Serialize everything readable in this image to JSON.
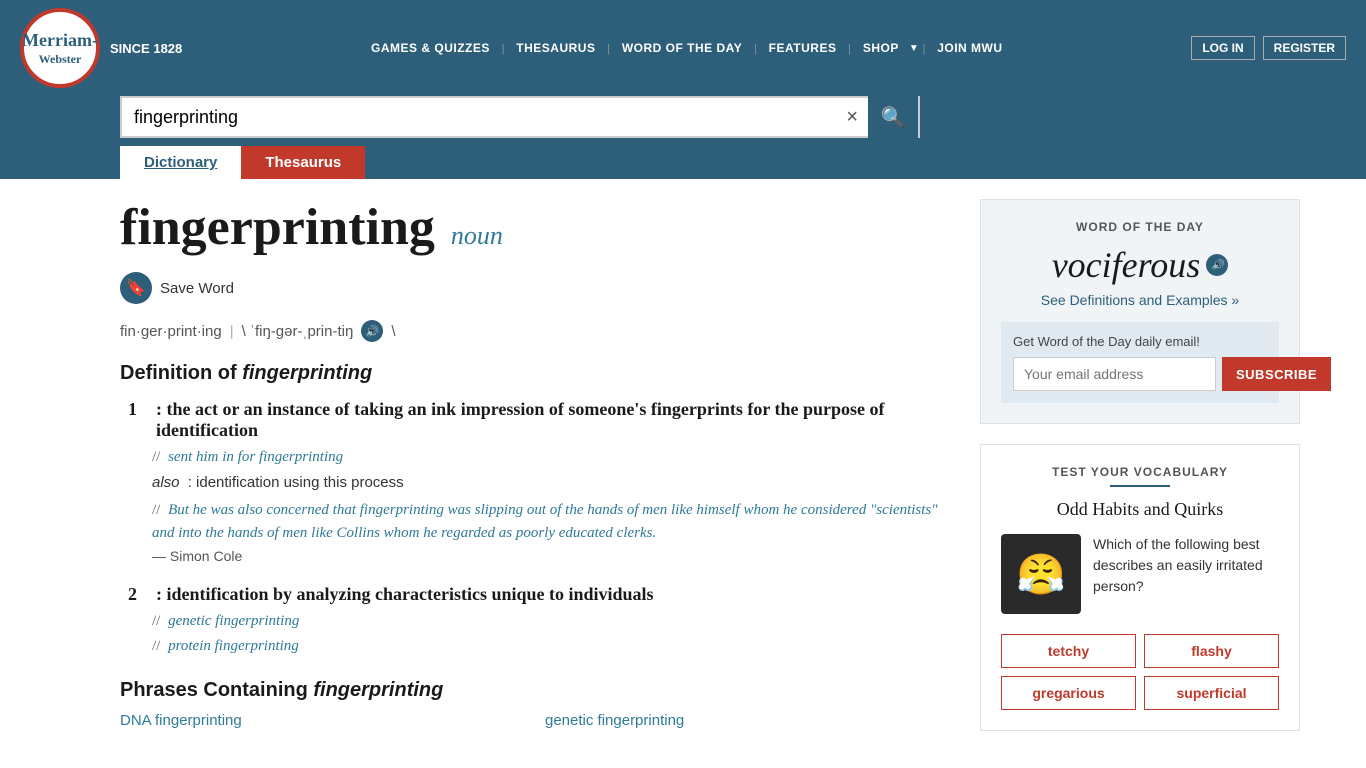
{
  "header": {
    "logo_line1": "Merriam-",
    "logo_line2": "Webster",
    "since": "SINCE 1828",
    "nav": {
      "games": "GAMES & QUIZZES",
      "thesaurus": "THESAURUS",
      "wotd": "WORD OF THE DAY",
      "features": "FEATURES",
      "shop": "SHOP",
      "join": "JOIN MWU",
      "login": "LOG IN",
      "register": "REGISTER"
    },
    "search_value": "fingerprinting",
    "search_clear": "×"
  },
  "tabs": {
    "dictionary": "Dictionary",
    "thesaurus": "Thesaurus"
  },
  "article": {
    "word": "fingerprinting",
    "pos": "noun",
    "save_word": "Save Word",
    "pronunciation_parts": "fin·ger·print·ing",
    "pronunciation_divider": "|",
    "pronunciation_phonetic": "\\ ˈfiŋ-gər-ˌprin-tiŋ",
    "pronunciation_close": "\\",
    "definition_heading": "Definition of fingerprinting",
    "definitions": [
      {
        "number": "1",
        "colon": ":",
        "text": "the act or an instance of taking an ink impression of someone's fingerprints for the purpose of identification",
        "examples": [
          "// sent him in for fingerprinting"
        ],
        "also": "also",
        "also_text": ": identification using this process",
        "quote": "// But he was also concerned that fingerprinting was slipping out of the hands of men like himself whom he considered \"scientists\" and into the hands of men like Collins whom he regarded as poorly educated clerks.",
        "attribution": "— Simon Cole"
      },
      {
        "number": "2",
        "colon": ":",
        "text": "identification by analyzing characteristics unique to individuals",
        "examples": [
          "// genetic fingerprinting",
          "// protein fingerprinting"
        ]
      }
    ],
    "phrases_heading": "Phrases Containing fingerprinting",
    "phrases": [
      "DNA fingerprinting",
      "genetic fingerprinting"
    ]
  },
  "sidebar": {
    "wotd": {
      "label": "WORD OF THE DAY",
      "word": "vociferous",
      "link_text": "See Definitions and Examples »",
      "email_label": "Get Word of the Day daily email!",
      "email_placeholder": "Your email address",
      "subscribe_label": "SUBSCRIBE"
    },
    "quiz": {
      "label": "TEST YOUR VOCABULARY",
      "title": "Odd Habits and Quirks",
      "question": "Which of the following best describes an easily irritated person?",
      "emoji": "😤",
      "options": [
        "tetchy",
        "flashy",
        "gregarious",
        "superficial"
      ]
    }
  }
}
